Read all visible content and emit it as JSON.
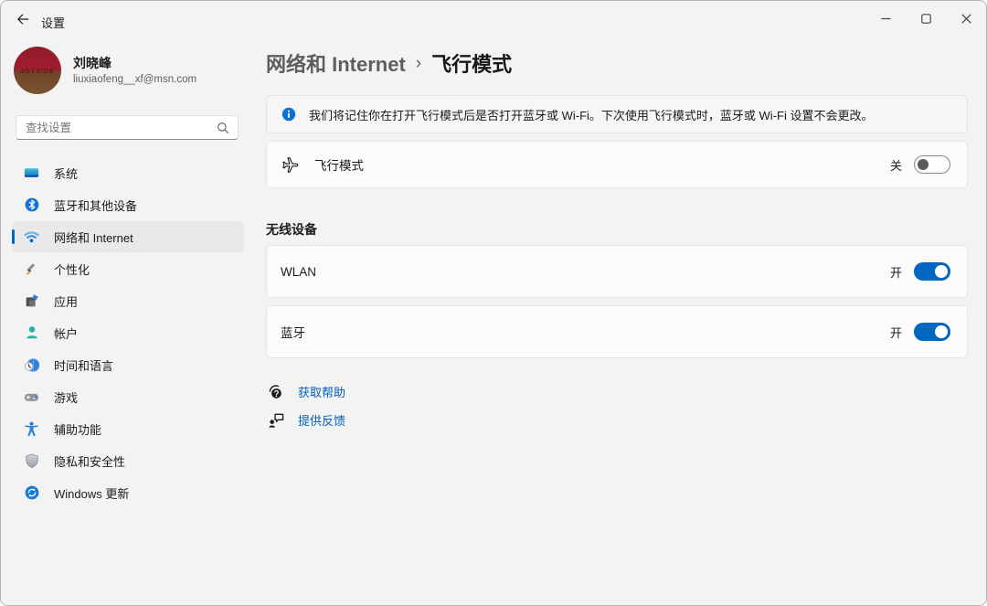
{
  "titlebar": {
    "app_title": "设置"
  },
  "profile": {
    "name": "刘晓峰",
    "email": "liuxiaofeng__xf@msn.com",
    "avatar_text": "JOYSIDE"
  },
  "search": {
    "placeholder": "查找设置"
  },
  "sidebar": {
    "items": [
      {
        "label": "系统"
      },
      {
        "label": "蓝牙和其他设备"
      },
      {
        "label": "网络和 Internet",
        "selected": true
      },
      {
        "label": "个性化"
      },
      {
        "label": "应用"
      },
      {
        "label": "帐户"
      },
      {
        "label": "时间和语言"
      },
      {
        "label": "游戏"
      },
      {
        "label": "辅助功能"
      },
      {
        "label": "隐私和安全性"
      },
      {
        "label": "Windows 更新"
      }
    ]
  },
  "breadcrumb": {
    "parent": "网络和 Internet",
    "separator": "›",
    "current": "飞行模式"
  },
  "banner": {
    "text": "我们将记住你在打开飞行模式后是否打开蓝牙或 Wi-Fi。下次使用飞行模式时，蓝牙或 Wi-Fi 设置不会更改。"
  },
  "airplane_mode": {
    "label": "飞行模式",
    "state_label": "关",
    "enabled": false
  },
  "wireless": {
    "section_title": "无线设备",
    "rows": [
      {
        "label": "WLAN",
        "state_label": "开",
        "enabled": true
      },
      {
        "label": "蓝牙",
        "state_label": "开",
        "enabled": true
      }
    ]
  },
  "help": {
    "links": [
      {
        "label": "获取帮助"
      },
      {
        "label": "提供反馈"
      }
    ]
  },
  "colors": {
    "accent": "#0067c0",
    "link": "#005fb8",
    "window_bg": "#f3f3f3",
    "card_bg": "#fbfbfb",
    "card_border": "#e5e5e5",
    "selected_nav_bg": "#e9e9e9"
  }
}
